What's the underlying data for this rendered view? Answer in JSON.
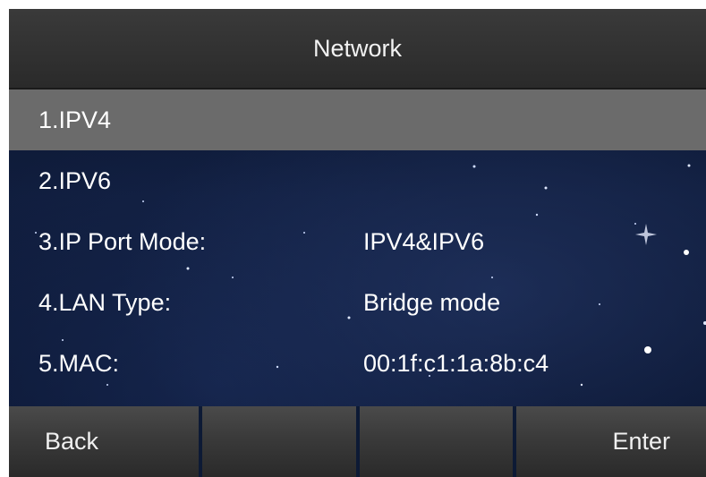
{
  "header": {
    "title": "Network"
  },
  "menu": {
    "items": [
      {
        "label": "1.IPV4",
        "value": ""
      },
      {
        "label": "2.IPV6",
        "value": ""
      },
      {
        "label": "3.IP Port Mode:",
        "value": "IPV4&IPV6"
      },
      {
        "label": "4.LAN Type:",
        "value": "Bridge mode"
      },
      {
        "label": "5.MAC:",
        "value": "00:1f:c1:1a:8b:c4"
      }
    ],
    "selected_index": 0
  },
  "softkeys": {
    "back_label": "Back",
    "key2_label": "",
    "key3_label": "",
    "enter_label": "Enter"
  },
  "colors": {
    "title_bar": "#2f2f2f",
    "selected_row": "#6b6b6b",
    "background": "#0b1630",
    "text": "#ffffff"
  }
}
